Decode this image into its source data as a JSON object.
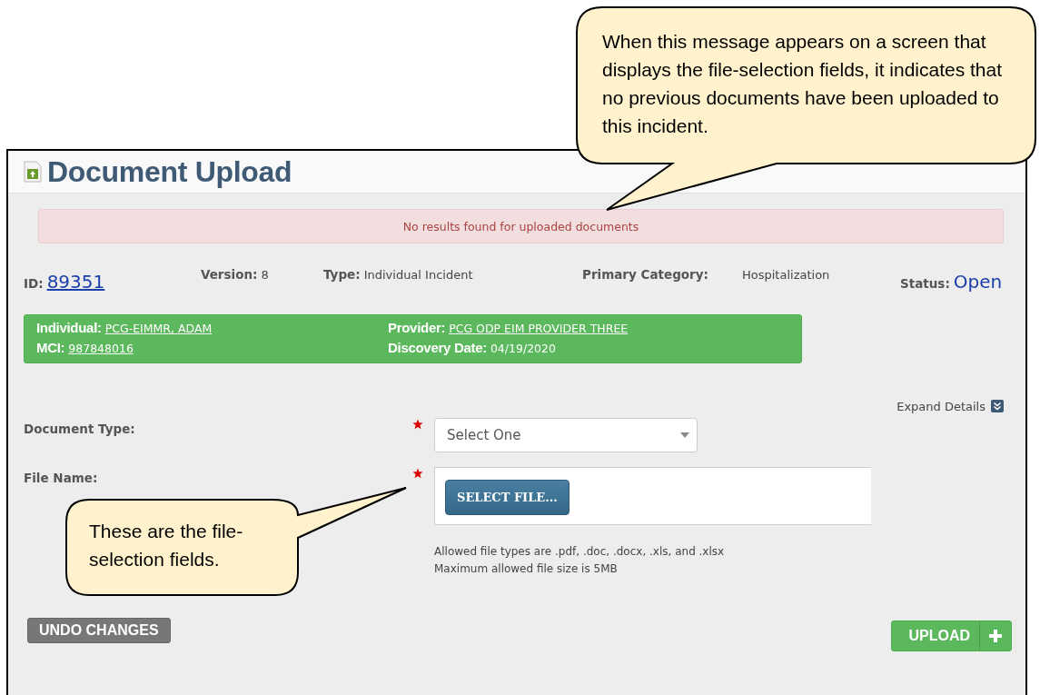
{
  "callouts": [
    {
      "text": "When this message appears on a screen that displays the file-selection fields, it indicates that no previous documents have been uploaded to this incident."
    },
    {
      "text": "These are the file-selection fields."
    }
  ],
  "page": {
    "title": "Document Upload",
    "alert": "No results found for uploaded documents",
    "info": [
      {
        "label": "ID:",
        "value": "89351",
        "kind": "link"
      },
      {
        "label": "Version:",
        "value": "8",
        "kind": "plain"
      },
      {
        "label": "Type:",
        "value": "Individual Incident",
        "kind": "plain"
      },
      {
        "label": "Primary Category:",
        "value": "Hospitalization",
        "kind": "wide"
      },
      {
        "label": "Status:",
        "value": "Open",
        "kind": "status"
      }
    ],
    "summary": [
      [
        {
          "label": "Individual:",
          "value": "PCG-EIMMR, ADAM",
          "link": true
        },
        {
          "label": "MCI:",
          "value": "987848016",
          "link": true
        }
      ],
      [
        {
          "label": "Provider:",
          "value": "PCG ODP EIM PROVIDER THREE",
          "link": true
        },
        {
          "label": "Discovery Date:",
          "value": "04/19/2020",
          "link": false
        }
      ]
    ],
    "expand": "Expand Details",
    "fields": [
      {
        "label": "Document Type:",
        "kind": "select",
        "required": true,
        "value": "Select One"
      },
      {
        "label": "File Name:",
        "kind": "file",
        "required": true,
        "button": "SELECT FILE..."
      }
    ],
    "hints": [
      "Allowed file types are .pdf, .doc, .docx, .xls, and .xlsx",
      "Maximum allowed file size is 5MB"
    ],
    "undo": "UNDO CHANGES",
    "upload": "UPLOAD"
  }
}
